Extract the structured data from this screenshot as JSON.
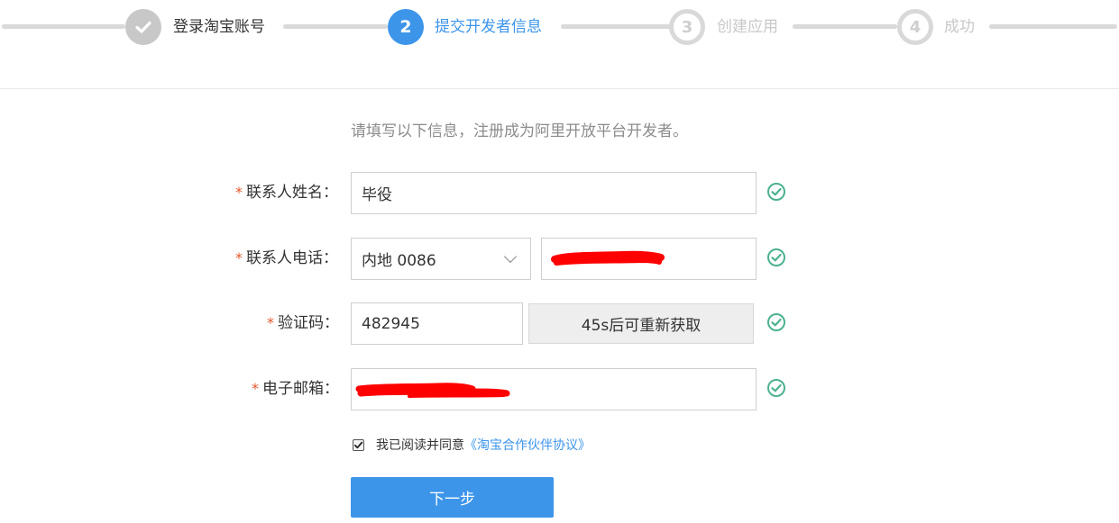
{
  "stepper": {
    "steps": [
      {
        "label": "登录淘宝账号",
        "state": "done",
        "icon": "checkmark-icon"
      },
      {
        "label": "提交开发者信息",
        "state": "active",
        "number": "2"
      },
      {
        "label": "创建应用",
        "state": "todo",
        "number": "3"
      },
      {
        "label": "成功",
        "state": "todo",
        "number": "4"
      }
    ]
  },
  "intro": "请填写以下信息，注册成为阿里开放平台开发者。",
  "form": {
    "required_mark": "*",
    "name": {
      "label": "联系人姓名：",
      "value": "毕役"
    },
    "phone": {
      "label": "联系人电话：",
      "region": "内地 0086",
      "value_redacted": true
    },
    "code": {
      "label": "验证码：",
      "value": "482945",
      "resend_label": "45s后可重新获取"
    },
    "email": {
      "label": "电子邮箱：",
      "value_redacted": true
    }
  },
  "agreement": {
    "checked": true,
    "text": "我已阅读并同意",
    "link": "《淘宝合作伙伴协议》"
  },
  "submit_label": "下一步",
  "colors": {
    "accent": "#3d95ea",
    "success": "#4cb28f",
    "required": "#e5572a",
    "redaction": "#ff0000"
  }
}
